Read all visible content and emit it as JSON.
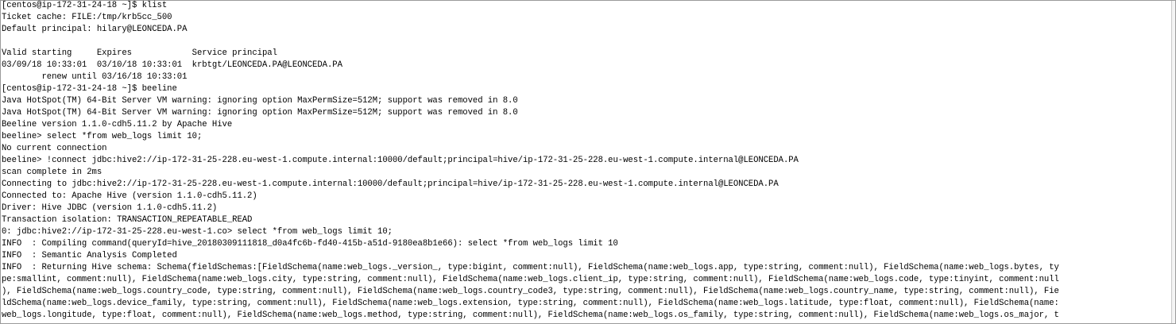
{
  "terminal": {
    "lines": [
      "[centos@ip-172-31-24-18 ~]$ klist",
      "Ticket cache: FILE:/tmp/krb5cc_500",
      "Default principal: hilary@LEONCEDA.PA",
      "",
      "Valid starting     Expires            Service principal",
      "03/09/18 10:33:01  03/10/18 10:33:01  krbtgt/LEONCEDA.PA@LEONCEDA.PA",
      "        renew until 03/16/18 10:33:01",
      "[centos@ip-172-31-24-18 ~]$ beeline",
      "Java HotSpot(TM) 64-Bit Server VM warning: ignoring option MaxPermSize=512M; support was removed in 8.0",
      "Java HotSpot(TM) 64-Bit Server VM warning: ignoring option MaxPermSize=512M; support was removed in 8.0",
      "Beeline version 1.1.0-cdh5.11.2 by Apache Hive",
      "beeline> select *from web_logs limit 10;",
      "No current connection",
      "beeline> !connect jdbc:hive2://ip-172-31-25-228.eu-west-1.compute.internal:10000/default;principal=hive/ip-172-31-25-228.eu-west-1.compute.internal@LEONCEDA.PA",
      "scan complete in 2ms",
      "Connecting to jdbc:hive2://ip-172-31-25-228.eu-west-1.compute.internal:10000/default;principal=hive/ip-172-31-25-228.eu-west-1.compute.internal@LEONCEDA.PA",
      "Connected to: Apache Hive (version 1.1.0-cdh5.11.2)",
      "Driver: Hive JDBC (version 1.1.0-cdh5.11.2)",
      "Transaction isolation: TRANSACTION_REPEATABLE_READ",
      "0: jdbc:hive2://ip-172-31-25-228.eu-west-1.co> select *from web_logs limit 10;",
      "INFO  : Compiling command(queryId=hive_20180309111818_d0a4fc6b-fd40-415b-a51d-9180ea8b1e66): select *from web_logs limit 10",
      "INFO  : Semantic Analysis Completed",
      "INFO  : Returning Hive schema: Schema(fieldSchemas:[FieldSchema(name:web_logs._version_, type:bigint, comment:null), FieldSchema(name:web_logs.app, type:string, comment:null), FieldSchema(name:web_logs.bytes, ty",
      "pe:smallint, comment:null), FieldSchema(name:web_logs.city, type:string, comment:null), FieldSchema(name:web_logs.client_ip, type:string, comment:null), FieldSchema(name:web_logs.code, type:tinyint, comment:null",
      "), FieldSchema(name:web_logs.country_code, type:string, comment:null), FieldSchema(name:web_logs.country_code3, type:string, comment:null), FieldSchema(name:web_logs.country_name, type:string, comment:null), Fie",
      "ldSchema(name:web_logs.device_family, type:string, comment:null), FieldSchema(name:web_logs.extension, type:string, comment:null), FieldSchema(name:web_logs.latitude, type:float, comment:null), FieldSchema(name:",
      "web_logs.longitude, type:float, comment:null), FieldSchema(name:web_logs.method, type:string, comment:null), FieldSchema(name:web_logs.os_family, type:string, comment:null), FieldSchema(name:web_logs.os_major, t"
    ]
  }
}
